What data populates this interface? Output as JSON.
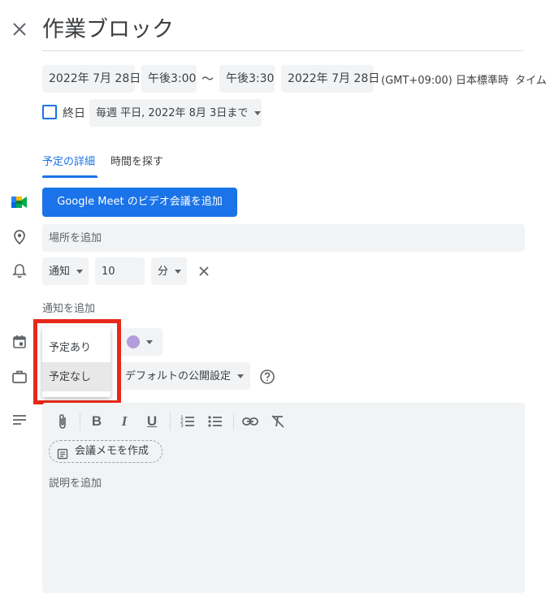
{
  "event": {
    "title": "作業ブロック"
  },
  "datetime": {
    "start_date": "2022年 7月 28日",
    "start_time": "午後3:00",
    "separator": "〜",
    "end_time": "午後3:30",
    "end_date": "2022年 7月 28日",
    "timezone": "(GMT+09:00) 日本標準時",
    "timezone_link": "タイム"
  },
  "allday": {
    "label": "終日",
    "checked": false
  },
  "recurrence": {
    "value": "毎週 平日, 2022年 8月 3日まで"
  },
  "tabs": [
    {
      "label": "予定の詳細",
      "active": true
    },
    {
      "label": "時間を探す",
      "active": false
    }
  ],
  "meet": {
    "button_label": "Google Meet のビデオ会議を追加"
  },
  "location": {
    "placeholder": "場所を追加"
  },
  "notification": {
    "type": "通知",
    "amount": "10",
    "unit": "分",
    "add_label": "通知を追加"
  },
  "busy_menu": {
    "options": [
      "予定あり",
      "予定なし"
    ],
    "highlighted": "予定なし"
  },
  "calendar_color": "#b39ddb",
  "visibility": {
    "value": "デフォルトの公開設定"
  },
  "description": {
    "meeting_notes_label": "会議メモを作成",
    "placeholder": "説明を追加"
  },
  "colors": {
    "accent": "#1a73e8",
    "highlight_box": "#e5291b",
    "field_bg": "#f1f3f4"
  }
}
